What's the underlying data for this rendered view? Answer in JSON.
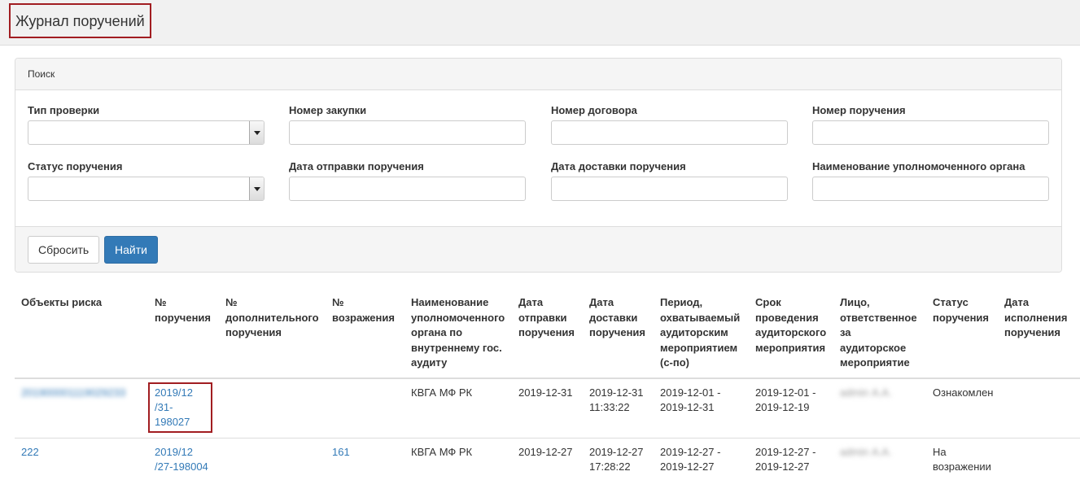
{
  "header": {
    "title": "Журнал поручений"
  },
  "search": {
    "heading": "Поиск",
    "fields": {
      "check_type": {
        "label": "Тип проверки",
        "value": ""
      },
      "purchase_number": {
        "label": "Номер закупки",
        "value": ""
      },
      "contract_number": {
        "label": "Номер договора",
        "value": ""
      },
      "order_number": {
        "label": "Номер поручения",
        "value": ""
      },
      "order_status": {
        "label": "Статус поручения",
        "value": ""
      },
      "send_date": {
        "label": "Дата отправки поручения",
        "value": ""
      },
      "delivery_date": {
        "label": "Дата доставки поручения",
        "value": ""
      },
      "authority_name": {
        "label": "Наименование уполномоченного органа",
        "value": ""
      }
    },
    "reset_label": "Сбросить",
    "find_label": "Найти"
  },
  "table": {
    "columns": [
      "Объекты риска",
      "№ поручения",
      "№ дополнительного поручения",
      "№ возражения",
      "Наименование уполномоченного органа по внутреннему гос. аудиту",
      "Дата отправки поручения",
      "Дата доставки поручения",
      "Период, охватываемый аудиторским мероприятием (с-по)",
      "Срок проведения аудиторского мероприятия",
      "Лицо, ответственное за аудиторское мероприятие",
      "Статус поручения",
      "Дата исполнения поручения"
    ],
    "rows": [
      {
        "risk_object": "201900001119029233",
        "order_number": "2019/12 /31-198027",
        "additional_order": "",
        "objection": "",
        "authority": "КВГА МФ РК",
        "send_date": "2019-12-31",
        "delivery_date": "2019-12-31 11:33:22",
        "period": "2019-12-01 - 2019-12-31",
        "term": "2019-12-01 - 2019-12-19",
        "responsible": "admin А.А.",
        "status": "Ознакомлен",
        "exec_date": ""
      },
      {
        "risk_object": "222",
        "order_number": "2019/12 /27-198004",
        "additional_order": "",
        "objection": "161",
        "authority": "КВГА МФ РК",
        "send_date": "2019-12-27",
        "delivery_date": "2019-12-27 17:28:22",
        "period": "2019-12-27 - 2019-12-27",
        "term": "2019-12-27 - 2019-12-27",
        "responsible": "admin А.А.",
        "status": "На возражении",
        "exec_date": ""
      }
    ]
  },
  "colors": {
    "accent": "#337ab7",
    "highlight": "#a11d21"
  }
}
